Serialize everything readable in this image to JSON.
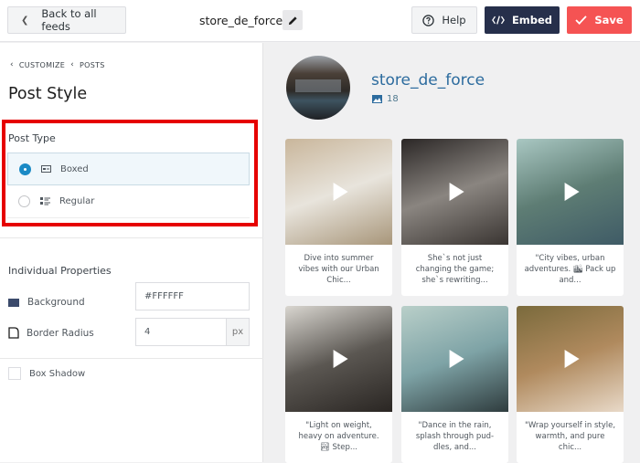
{
  "topbar": {
    "back_label": "Back to all feeds",
    "feed_name": "store_de_force",
    "help_label": "Help",
    "embed_label": "Embed",
    "save_label": "Save"
  },
  "sidebar": {
    "breadcrumb": [
      "CUSTOMIZE",
      "POSTS"
    ],
    "title": "Post Style",
    "post_type": {
      "label": "Post Type",
      "options": [
        {
          "label": "Boxed",
          "selected": true,
          "icon": "boxed-layout-icon"
        },
        {
          "label": "Regular",
          "selected": false,
          "icon": "list-layout-icon"
        }
      ]
    },
    "individual_properties": {
      "label": "Individual Properties",
      "background": {
        "label": "Background",
        "value": "#FFFFFF",
        "swatch_color": "#3b4a6b"
      },
      "border_radius": {
        "label": "Border Radius",
        "value": "4",
        "unit": "px"
      },
      "box_shadow": {
        "label": "Box Shadow",
        "checked": false
      }
    }
  },
  "preview": {
    "profile": {
      "name": "store_de_force",
      "post_count": "18"
    },
    "posts": [
      {
        "caption": "Dive into summer vibes with our Urban Chic...",
        "thumb_colors": [
          "#c9b69b",
          "#e8e4dc",
          "#a8967a"
        ]
      },
      {
        "caption": "She`s not just changing the game; she`s rewriting...",
        "thumb_colors": [
          "#2b2726",
          "#8a8580",
          "#3a3532"
        ]
      },
      {
        "caption": "\"City vibes, urban adventures. 🏙 Pack up and...",
        "thumb_colors": [
          "#a9c7c2",
          "#5e7d74",
          "#3f5b66"
        ]
      },
      {
        "caption": "\"Light on weight, heavy on adventure. 🏞 Step...",
        "thumb_colors": [
          "#d9d6d0",
          "#5b5752",
          "#2a2623"
        ]
      },
      {
        "caption": "\"Dance in the rain, splash through pud-dles, and...",
        "thumb_colors": [
          "#b9cfc9",
          "#7ea3a6",
          "#2f3c3e"
        ]
      },
      {
        "caption": "\"Wrap yourself in style, warmth, and pure chic...",
        "thumb_colors": [
          "#7a6a3c",
          "#b08a5e",
          "#e8d9c8"
        ]
      }
    ]
  },
  "colors": {
    "accent_blue": "#1b8ac5",
    "embed_bg": "#262f4b",
    "save_bg": "#f55353",
    "highlight_border": "#e60000",
    "profile_name": "#2c6b9e"
  }
}
